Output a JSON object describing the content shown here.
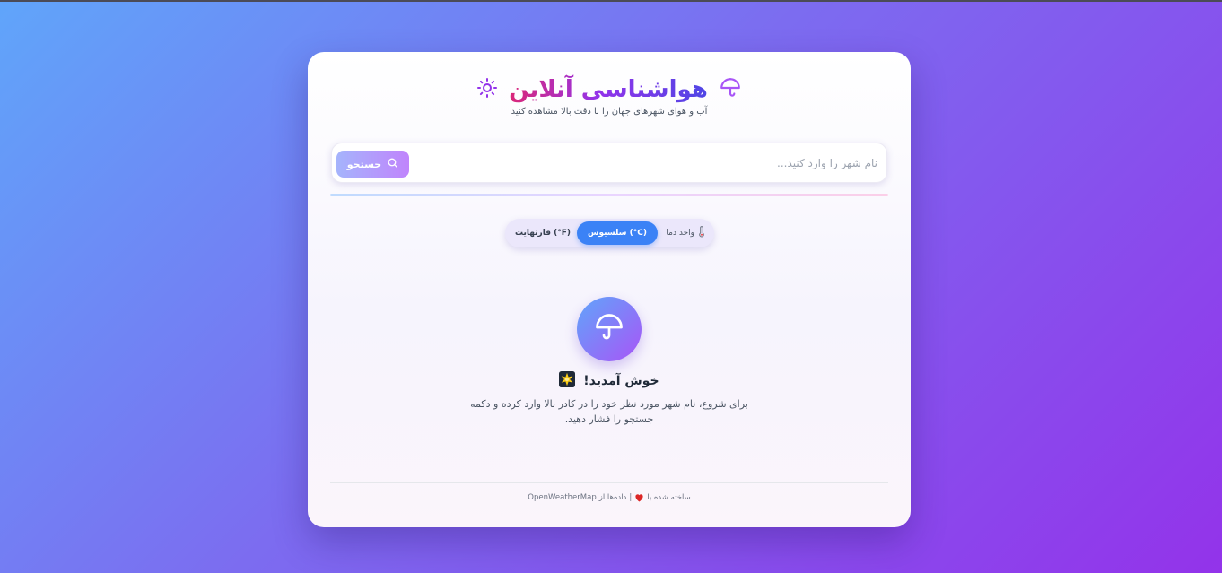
{
  "header": {
    "title": "هواشناسی آنلاین",
    "subtitle": "آب و هوای شهرهای جهان را با دقت بالا مشاهده کنید",
    "left_icon": "sun-icon",
    "right_icon": "umbrella-icon"
  },
  "search": {
    "placeholder": "نام شهر را وارد کنید...",
    "value": "",
    "button_label": "جستجو",
    "button_icon": "search-icon"
  },
  "units": {
    "label": "واحد دما",
    "label_icon": "thermometer-icon",
    "celsius": "سلسیوس (°C)",
    "fahrenheit": "فارنهایت (°F)",
    "selected": "celsius"
  },
  "welcome": {
    "icon": "umbrella-icon",
    "title": "خوش آمدید!",
    "title_icon": "sparkle-icon",
    "text": "برای شروع، نام شهر مورد نظر خود را در کادر بالا وارد کرده و دکمه جستجو را فشار دهید."
  },
  "footer": {
    "made_with": "ساخته شده با",
    "separator": "|",
    "data_from": "داده‌ها از",
    "provider": "OpenWeatherMap"
  },
  "colors": {
    "accent_blue": "#3b82f6",
    "accent_purple": "#9333ea",
    "accent_pink": "#db2777"
  }
}
